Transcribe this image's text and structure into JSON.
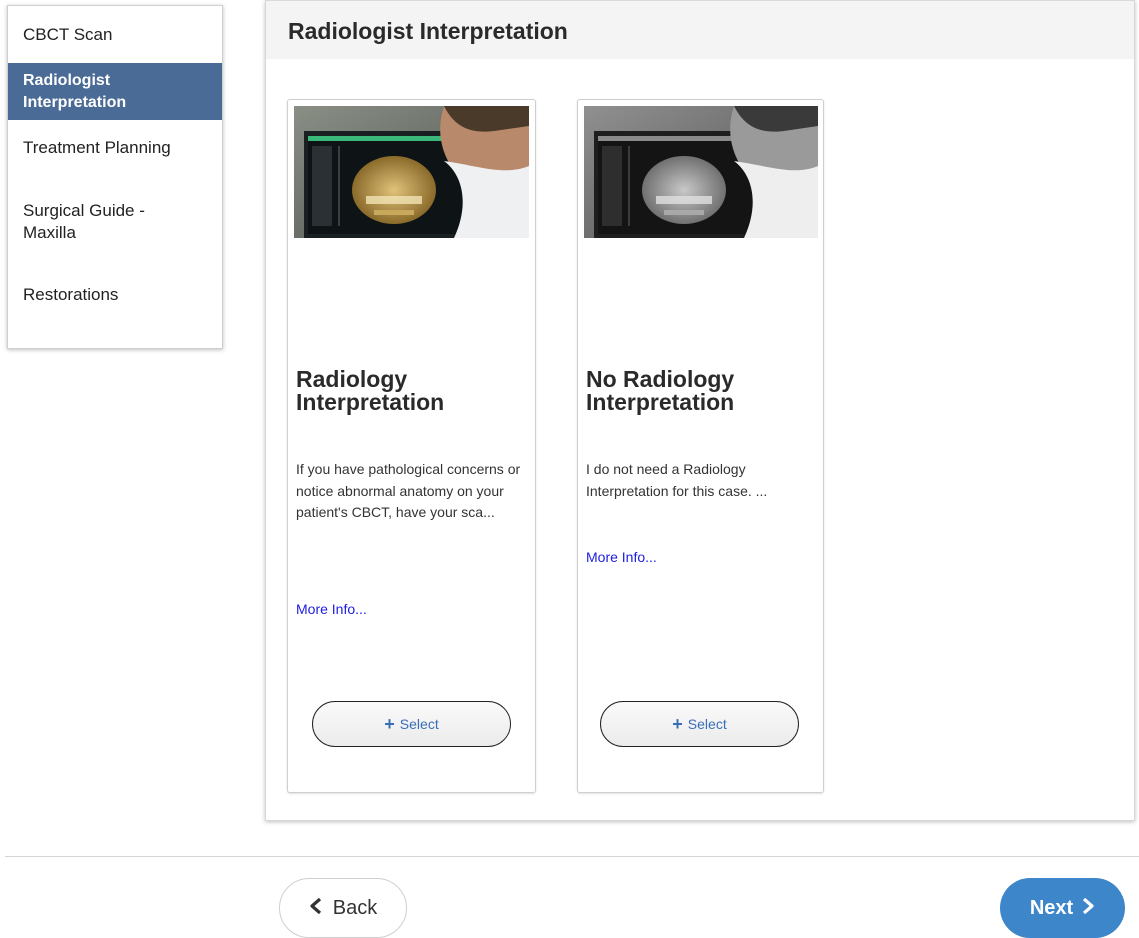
{
  "sidebar": {
    "items": [
      {
        "label": "CBCT Scan",
        "active": false
      },
      {
        "label": "Radiologist Interpretation",
        "active": true
      },
      {
        "label": "Treatment Planning",
        "active": false
      },
      {
        "label": "Surgical Guide - Maxilla",
        "active": false
      },
      {
        "label": "Restorations",
        "active": false
      }
    ]
  },
  "panel": {
    "title": "Radiologist Interpretation"
  },
  "cards": [
    {
      "title": "Radiology Interpretation",
      "description": "If you have pathological concerns or notice abnormal anatomy on your patient's CBCT, have your sca...",
      "more_info": "More Info...",
      "select_label": "Select",
      "image": "radiologist-viewing-cbct-color"
    },
    {
      "title": "No Radiology Interpretation",
      "description": "I do not need a Radiology Interpretation for this case. ...",
      "more_info": "More Info...",
      "select_label": "Select",
      "image": "radiologist-viewing-cbct-grayscale"
    }
  ],
  "footer": {
    "back_label": "Back",
    "next_label": "Next"
  },
  "colors": {
    "sidebar_active": "#4a6b96",
    "next_button": "#3d86c9",
    "link": "#1d1de0",
    "select_text": "#3a6fb8"
  }
}
